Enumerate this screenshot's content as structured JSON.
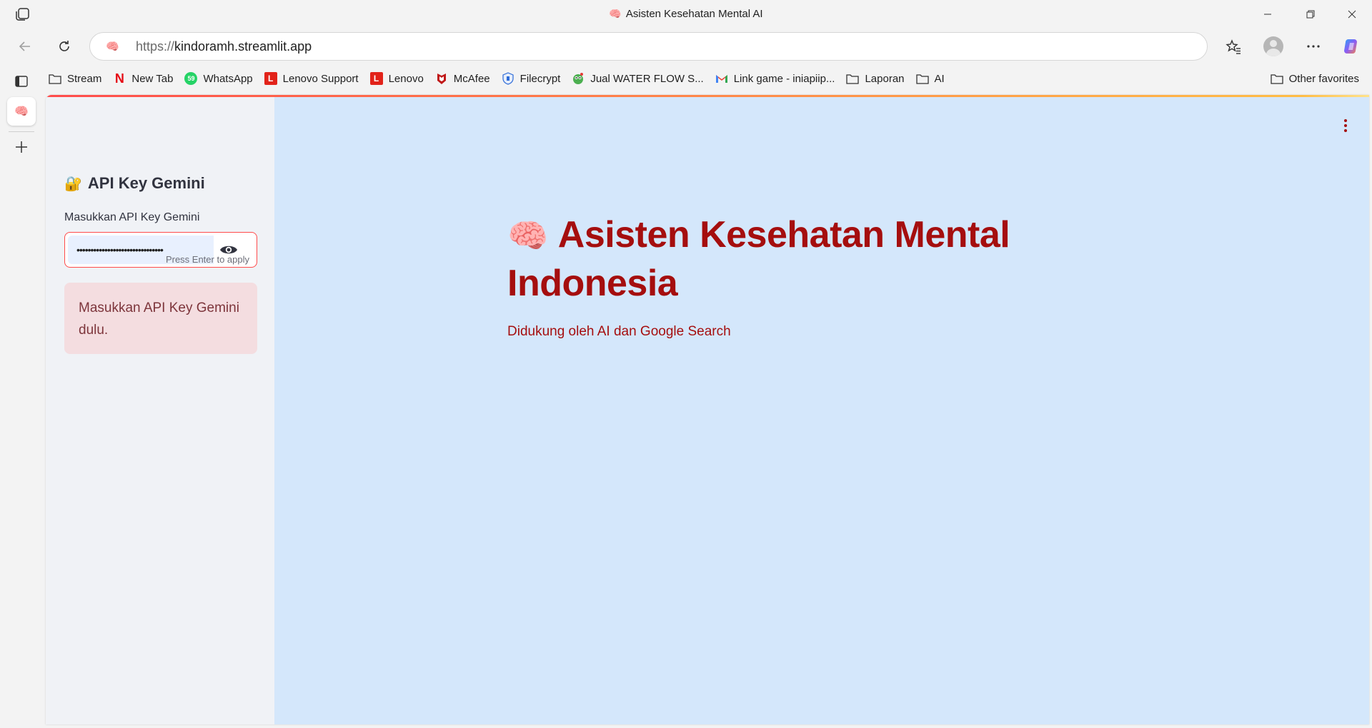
{
  "window": {
    "title": "Asisten Kesehatan Mental AI",
    "favicon": "🧠"
  },
  "address_bar": {
    "scheme": "https://",
    "host": "kindoramh.streamlit.app"
  },
  "bookmarks": [
    {
      "label": "Stream",
      "icon": "folder-icon"
    },
    {
      "label": "New Tab",
      "icon": "netflix-icon"
    },
    {
      "label": "WhatsApp",
      "icon": "whatsapp-icon"
    },
    {
      "label": "Lenovo Support",
      "icon": "lenovo-icon"
    },
    {
      "label": "Lenovo",
      "icon": "lenovo-icon"
    },
    {
      "label": "McAfee",
      "icon": "mcafee-icon"
    },
    {
      "label": "Filecrypt",
      "icon": "filecrypt-icon"
    },
    {
      "label": "Jual WATER FLOW S...",
      "icon": "shop-icon"
    },
    {
      "label": "Link game - iniapiip...",
      "icon": "gmail-icon"
    },
    {
      "label": "Laporan",
      "icon": "folder-icon"
    },
    {
      "label": "AI",
      "icon": "folder-icon"
    }
  ],
  "other_favorites": "Other favorites",
  "sidebar": {
    "header_icon": "🔐",
    "header": "API Key Gemini",
    "input_label": "Masukkan API Key Gemini",
    "input_value": "•••••••••••••••••••••••••••••••",
    "input_hint": "Press Enter to apply",
    "alert_text": "Masukkan API Key Gemini dulu."
  },
  "main": {
    "title_icon": "🧠",
    "title": "Asisten Kesehatan Mental Indonesia",
    "subtitle": "Didukung oleh AI dan Google Search"
  },
  "colors": {
    "main_bg": "#d4e7fb",
    "title_color": "#a50e0e",
    "sidebar_bg": "#f0f2f6",
    "alert_bg": "#f4dde0",
    "accent_red": "#ff4b4b"
  }
}
